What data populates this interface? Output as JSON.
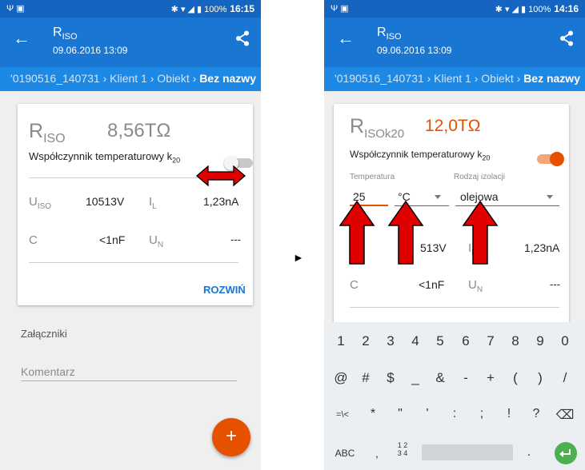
{
  "colors": {
    "primary": "#1976d2",
    "status_bar": "#1565c0",
    "accent": "#e65100",
    "breadcrumb_bg": "#1e88e5"
  },
  "status_bar": {
    "left_icons": "Ψ ▣",
    "right_icons": "✱ ▾ ◢ ▮",
    "left_time": "16:15",
    "right_time": "14:16",
    "battery": "100%"
  },
  "header": {
    "title_main": "R",
    "title_sub": "ISO",
    "date": "09.06.2016 13:09",
    "back_icon": "arrow-left",
    "share_icon": "share"
  },
  "breadcrumb": {
    "path": "'0190516_140731 › Klient 1 › Obiekt › ",
    "current": "Bez nazwy"
  },
  "left_screen": {
    "result_label_main": "R",
    "result_label_sub": "ISO",
    "result_value": "8,56TΩ",
    "coef_label": "Współczynnik temperaturowy k",
    "coef_sub": "20",
    "uiso_main": "U",
    "uiso_sub": "ISO",
    "uiso_value": "10513V",
    "il_main": "I",
    "il_sub": "L",
    "il_value": "1,23nA",
    "c_label": "C",
    "c_value": "<1nF",
    "un_main": "U",
    "un_sub": "N",
    "un_value": "---",
    "expand_button": "ROZWIŃ",
    "attachments_label": "Załączniki",
    "comment_placeholder": "Komentarz",
    "fab_label": "+"
  },
  "right_screen": {
    "result_label_main": "R",
    "result_label_sub": "ISOk20",
    "result_value": "12,0TΩ",
    "coef_label": "Współczynnik temperaturowy k",
    "coef_sub": "20",
    "temperature_label": "Temperatura",
    "temperature_value": "25",
    "unit_value": "°C",
    "insulation_label": "Rodzaj izolacji",
    "insulation_value": "olejowa",
    "uiso_value": "513V",
    "il_main": "I",
    "il_sub": "L",
    "il_value": "1,23nA",
    "c_label": "C",
    "c_value": "<1nF",
    "un_main": "U",
    "un_sub": "N",
    "un_value": "---",
    "uiso_main": "U"
  },
  "keyboard": {
    "row1": [
      "1",
      "2",
      "3",
      "4",
      "5",
      "6",
      "7",
      "8",
      "9",
      "0"
    ],
    "row2": [
      "@",
      "#",
      "$",
      "_",
      "&",
      "-",
      "+",
      "(",
      ")",
      "/"
    ],
    "row3": [
      "=\\<",
      "*",
      "\"",
      "'",
      ":",
      ";",
      "!",
      "?",
      "⌫"
    ],
    "abc": "ABC",
    "comma": ",",
    "numpad_top": "1 2",
    "numpad_bottom": "3 4",
    "period": "."
  },
  "arrow_between": "►"
}
